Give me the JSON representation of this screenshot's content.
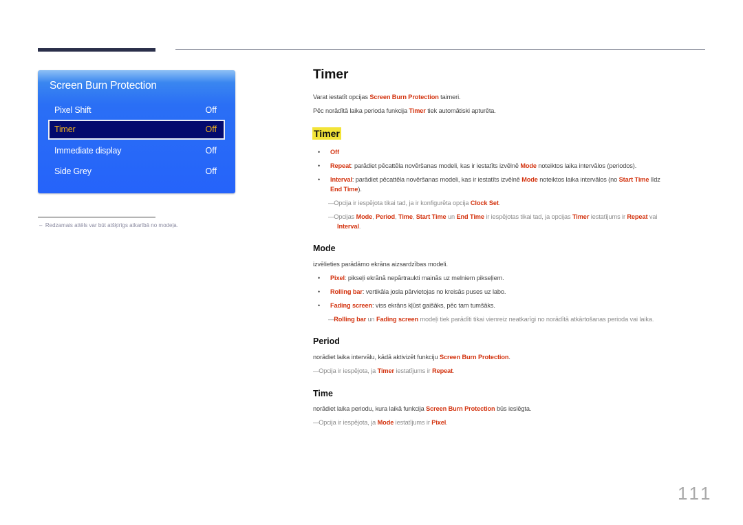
{
  "osd": {
    "title": "Screen Burn Protection",
    "items": [
      {
        "label": "Pixel Shift",
        "value": "Off",
        "selected": false
      },
      {
        "label": "Timer",
        "value": "Off",
        "selected": true
      },
      {
        "label": "Immediate display",
        "value": "Off",
        "selected": false
      },
      {
        "label": "Side Grey",
        "value": "Off",
        "selected": false
      }
    ],
    "colors": {
      "panel": "#2563fa",
      "selected_bg": "#030a6e",
      "selected_text": "#f2b21c"
    }
  },
  "footnote": "Redzamais attēls var būt atšķirīgs atkarībā no modeļa.",
  "main": {
    "title": "Timer",
    "intro1": {
      "a": "Varat iestatīt opcijas ",
      "b": "Screen Burn Protection",
      "c": " taimeri."
    },
    "intro2": {
      "a": "Pēc norādītā laika perioda funkcija ",
      "b": "Timer",
      "c": " tiek automātiski apturēta."
    },
    "timer_heading": "Timer",
    "timer_bullets": [
      {
        "term": "Off",
        "rest": ""
      },
      {
        "term": "Repeat",
        "rest1": ": parādiet pēcattēla novēršanas modeli, kas ir iestatīts izvēlnē ",
        "k1": "Mode",
        "rest2": " noteiktos laika intervālos (periodos)."
      },
      {
        "term": "Interval",
        "rest1": ": parādiet pēcattēla novēršanas modeli, kas ir iestatīts izvēlnē ",
        "k1": "Mode",
        "rest2": " noteiktos laika intervālos (no ",
        "k2": "Start Time",
        "rest3": " līdz",
        "k3": "End Time",
        "rest4": ")."
      }
    ],
    "timer_notes": [
      {
        "a": "Opcija ir iespējota tikai tad, ja ir konfigurēta opcija ",
        "k1": "Clock Set",
        "b": "."
      },
      {
        "a": "Opcijas ",
        "k1": "Mode",
        "s1": ", ",
        "k2": "Period",
        "s2": ", ",
        "k3": "Time",
        "s3": ", ",
        "k4": "Start Time",
        "s4": " un ",
        "k5": "End Time",
        "s5": " ir iespējotas tikai tad, ja opcijas ",
        "k6": "Timer",
        "s6": " iestatījums ir ",
        "k7": "Repeat",
        "s7": " vai",
        "k8": "Interval",
        "s8": "."
      }
    ],
    "mode": {
      "heading": "Mode",
      "desc": "izvēlieties parādāmo ekrāna aizsardzības modeli.",
      "bullets": [
        {
          "term": "Pixel",
          "rest": ": pikseļi ekrānā nepārtraukti mainās uz melniem pikseļiem."
        },
        {
          "term": "Rolling bar",
          "rest": ": vertikāla josla pārvietojas no kreisās puses uz labo."
        },
        {
          "term": "Fading screen",
          "rest": ": viss ekrāns kļūst gaišāks, pēc tam tumšāks."
        }
      ],
      "note": {
        "k1": "Rolling bar",
        "a": " un ",
        "k2": "Fading screen",
        "b": " modeļi tiek parādīti tikai vienreiz neatkarīgi no norādītā atkārtošanas perioda vai laika."
      }
    },
    "period": {
      "heading": "Period",
      "desc": {
        "a": "norādiet laika intervālu, kādā aktivizēt funkciju ",
        "k1": "Screen Burn Protection",
        "b": "."
      },
      "note": {
        "a": "Opcija ir iespējota, ja ",
        "k1": "Timer",
        "b": " iestatījums ir ",
        "k2": "Repeat",
        "c": "."
      }
    },
    "time": {
      "heading": "Time",
      "desc": {
        "a": "norādiet laika periodu, kura laikā funkcija ",
        "k1": "Screen Burn Protection",
        "b": " būs ieslēgta."
      },
      "note": {
        "a": "Opcija ir iespējota, ja ",
        "k1": "Mode",
        "b": " iestatījums ir ",
        "k2": "Pixel",
        "c": "."
      }
    }
  },
  "page_number": "111",
  "accent_color": "#d3330f",
  "bullet_glyph": "•",
  "note_glyph": "—",
  "footnote_glyph": "–"
}
